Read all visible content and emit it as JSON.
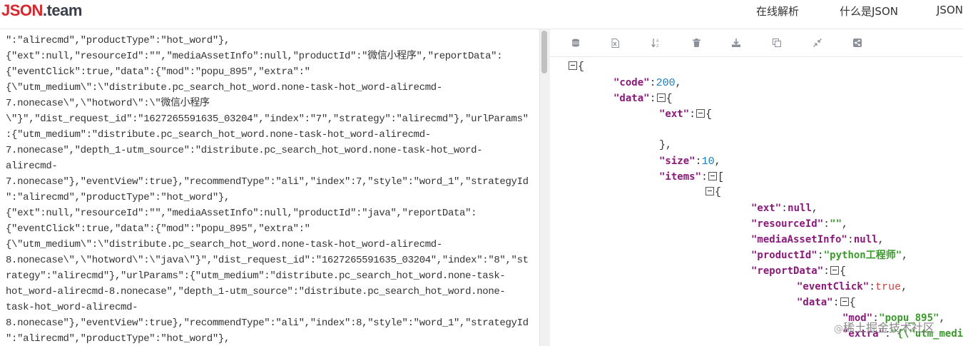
{
  "header": {
    "logo_red": "JSON",
    "logo_dark": ".team",
    "nav": [
      "在线解析",
      "什么是JSON",
      "JSON"
    ]
  },
  "editor_lines": [
    "\":\"alirecmd\",\"productType\":\"hot_word\"},",
    "{\"ext\":null,\"resourceId\":\"\",\"mediaAssetInfo\":null,\"productId\":\"微信小程序\",\"reportData\":",
    "{\"eventClick\":true,\"data\":{\"mod\":\"popu_895\",\"extra\":\"",
    "{\\\"utm_medium\\\":\\\"distribute.pc_search_hot_word.none-task-hot_word-alirecmd-",
    "7.nonecase\\\",\\\"hotword\\\":\\\"微信小程序",
    "\\\"}\",\"dist_request_id\":\"1627265591635_03204\",\"index\":\"7\",\"strategy\":\"alirecmd\"},\"urlParams\"",
    ":{\"utm_medium\":\"distribute.pc_search_hot_word.none-task-hot_word-alirecmd-",
    "7.nonecase\",\"depth_1-utm_source\":\"distribute.pc_search_hot_word.none-task-hot_word-",
    "alirecmd-",
    "7.nonecase\"},\"eventView\":true},\"recommendType\":\"ali\",\"index\":7,\"style\":\"word_1\",\"strategyId",
    "\":\"alirecmd\",\"productType\":\"hot_word\"},",
    "{\"ext\":null,\"resourceId\":\"\",\"mediaAssetInfo\":null,\"productId\":\"java\",\"reportData\":",
    "{\"eventClick\":true,\"data\":{\"mod\":\"popu_895\",\"extra\":\"",
    "{\\\"utm_medium\\\":\\\"distribute.pc_search_hot_word.none-task-hot_word-alirecmd-",
    "8.nonecase\\\",\\\"hotword\\\":\\\"java\\\"}\",\"dist_request_id\":\"1627265591635_03204\",\"index\":\"8\",\"st",
    "rategy\":\"alirecmd\"},\"urlParams\":{\"utm_medium\":\"distribute.pc_search_hot_word.none-task-",
    "hot_word-alirecmd-8.nonecase\",\"depth_1-utm_source\":\"distribute.pc_search_hot_word.none-",
    "task-hot_word-alirecmd-",
    "8.nonecase\"},\"eventView\":true},\"recommendType\":\"ali\",\"index\":8,\"style\":\"word_1\",\"strategyId",
    "\":\"alirecmd\",\"productType\":\"hot_word\"},"
  ],
  "toolbar_icons": [
    "database-icon",
    "excel-icon",
    "sort-icon",
    "trash-icon",
    "download-icon",
    "copy-icon",
    "compress-icon",
    "share-icon"
  ],
  "tree": {
    "open_brace": "{",
    "code_key": "\"code\"",
    "code_val": "200",
    "data_key": "\"data\"",
    "ext_key": "\"ext\"",
    "ext_close": "},",
    "size_key": "\"size\"",
    "size_val": "10",
    "items_key": "\"items\"",
    "item_ext_key": "\"ext\"",
    "item_ext_val": "null",
    "resourceId_key": "\"resourceId\"",
    "resourceId_val": "\"\"",
    "mediaAssetInfo_key": "\"mediaAssetInfo\"",
    "mediaAssetInfo_val": "null",
    "productId_key": "\"productId\"",
    "productId_val": "\"python工程师\"",
    "reportData_key": "\"reportData\"",
    "eventClick_key": "\"eventClick\"",
    "eventClick_val": "true",
    "rd_data_key": "\"data\"",
    "mod_key": "\"mod\"",
    "mod_val": "\"popu_895\"",
    "extra_key": "\"extra\"",
    "extra_val": "\"{\\\"utm_medi"
  },
  "watermark": {
    "at": "@",
    "text": "稀土掘金技术社区"
  }
}
